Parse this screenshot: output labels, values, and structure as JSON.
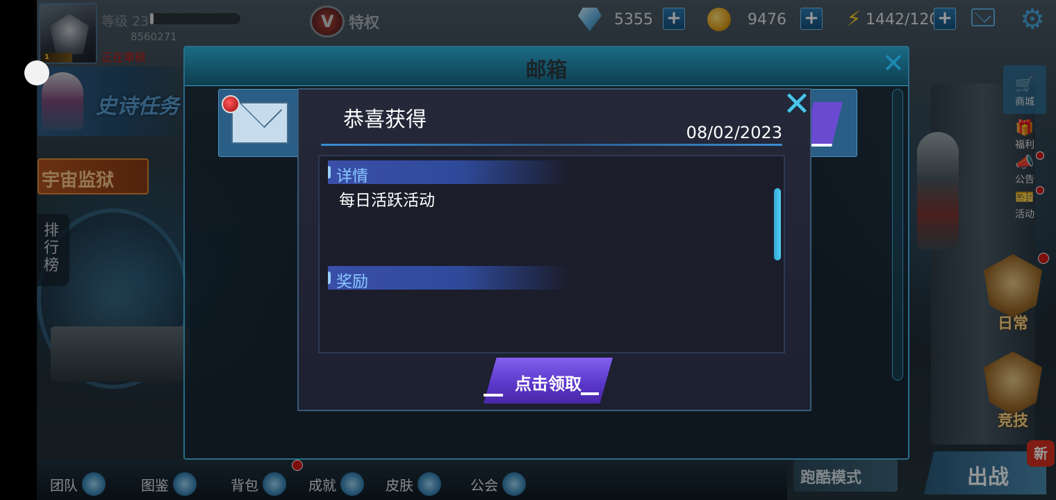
{
  "player": {
    "level_label": "等级 23",
    "level_progress": 0.03,
    "uid": "8560271",
    "review_status": "正在审核",
    "avatar_badge": "1"
  },
  "header": {
    "privilege_label": "特权",
    "diamonds": "5355",
    "coins": "9476",
    "energy": "1442/120",
    "plus_icon": "plus-icon",
    "mail_icon": "mail-icon",
    "settings_icon": "gear-icon"
  },
  "left_panel": {
    "epic_task": "史诗任务",
    "prison": "宇宙监狱",
    "ranking": "排行榜"
  },
  "right_panel": {
    "shop": "商城",
    "welfare": "福利",
    "notice": "公告",
    "events": "活动",
    "daily": "日常",
    "arena": "竞技",
    "new_badge": "新"
  },
  "bottom_nav": {
    "team": "团队",
    "codex": "图鉴",
    "bag": "背包",
    "achievements": "成就",
    "skins": "皮肤",
    "guild": "公会",
    "parkour": "跑酷模式",
    "battle": "出战"
  },
  "mailbox": {
    "title": "邮箱"
  },
  "dialog": {
    "title": "恭喜获得",
    "date": "08/02/2023",
    "details_header": "详情",
    "details_text": "每日活跃活动",
    "rewards_header": "奖励",
    "claim_button": "点击领取"
  },
  "colors": {
    "accent_blue": "#3b8fd2",
    "claim_purple": "#6a46dc",
    "section_header_text": "#8ac8ff",
    "alert_red": "#d01818"
  }
}
